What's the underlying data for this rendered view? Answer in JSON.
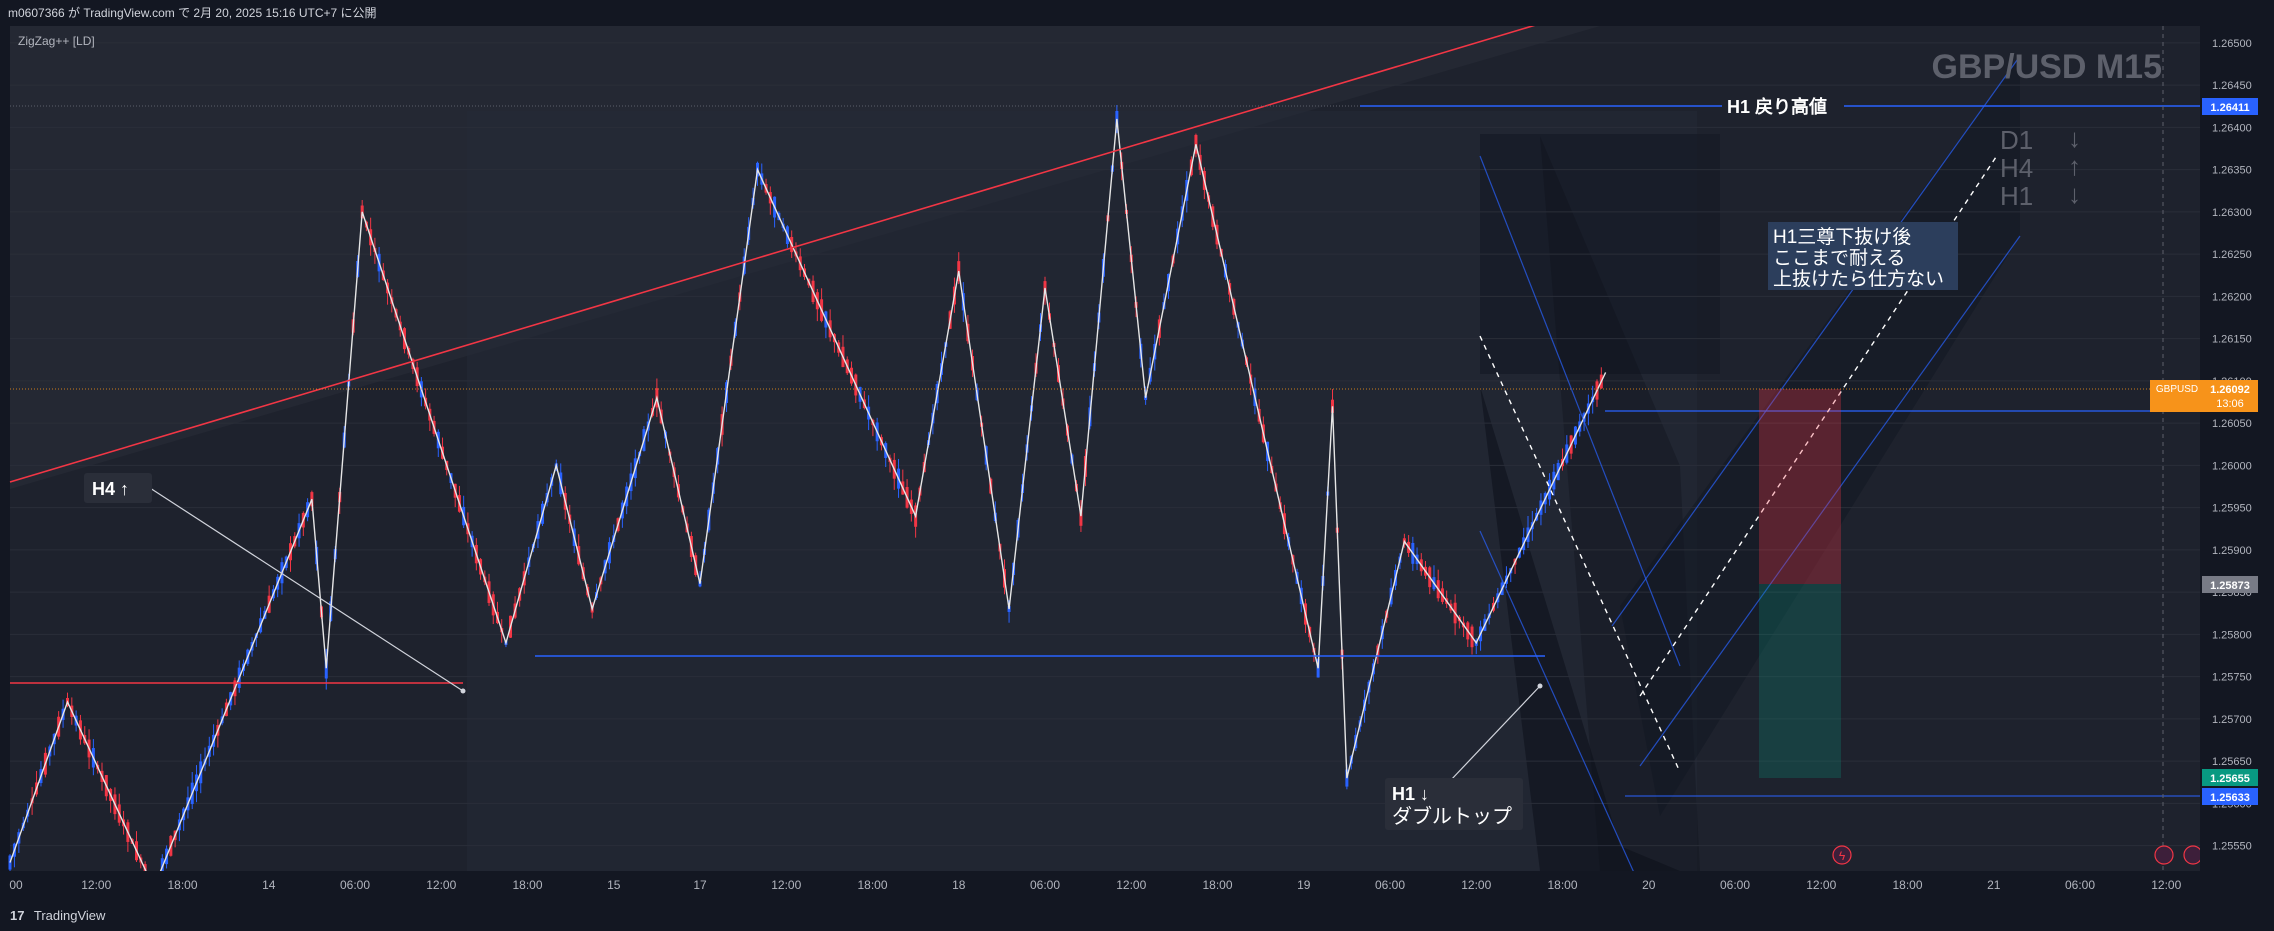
{
  "header": {
    "publish_line": "m0607366 が TradingView.com で 2月 20, 2025 15:16 UTC+7 に公開"
  },
  "footer": {
    "logo": "17",
    "brand": "TradingView"
  },
  "indicator_label": "ZigZag++ [LD]",
  "watermark": "GBP/USD M15",
  "trend_panel": [
    {
      "tf": "D1",
      "arrow": "↓"
    },
    {
      "tf": "H4",
      "arrow": "↑"
    },
    {
      "tf": "H1",
      "arrow": "↓"
    }
  ],
  "annotations": {
    "h1_high": "H1 戻り高値",
    "h4_up": "H4 ↑",
    "h1_down_title": "H1 ↓",
    "h1_down_sub": "ダブルトップ",
    "note_lines": [
      "H1三尊下抜け後",
      "ここまで耐える",
      "上抜けたら仕方ない"
    ]
  },
  "price_axis": {
    "ticks": [
      "1.26500",
      "1.26450",
      "1.26400",
      "1.26350",
      "1.26300",
      "1.26250",
      "1.26200",
      "1.26150",
      "1.26100",
      "1.26050",
      "1.26000",
      "1.25950",
      "1.25900",
      "1.25850",
      "1.25800",
      "1.25750",
      "1.25700",
      "1.25650",
      "1.25600",
      "1.25550"
    ],
    "current_symbol": "GBPUSD",
    "current_price": "1.26092",
    "countdown": "13:06",
    "level_high": "1.26411",
    "level_tp": "1.25873",
    "level_green": "1.25655",
    "level_low": "1.25633"
  },
  "time_axis": {
    "labels": [
      "00",
      "12:00",
      "18:00",
      "14",
      "06:00",
      "12:00",
      "18:00",
      "15",
      "17",
      "12:00",
      "18:00",
      "18",
      "06:00",
      "12:00",
      "18:00",
      "19",
      "06:00",
      "12:00",
      "18:00",
      "20",
      "06:00",
      "12:00",
      "18:00",
      "21",
      "06:00",
      "12:00"
    ]
  },
  "colors": {
    "background": "#131722",
    "bull": "#2962ff",
    "bear": "#f23645",
    "zigzag": "#e6e6e6",
    "resistance": "#f23645",
    "level_blue": "#2962ff",
    "current_price": "#f7931a",
    "tp_green": "#089981"
  },
  "chart_data": {
    "type": "candlestick",
    "symbol": "GBPUSD",
    "timeframe": "M15",
    "ylim": [
      1.2552,
      1.2652
    ],
    "zigzag_pivots": [
      {
        "x": "13 12:00",
        "y": 1.2553
      },
      {
        "x": "13 16:00",
        "y": 1.2572
      },
      {
        "x": "13 22:00",
        "y": 1.255
      },
      {
        "x": "14 09:00",
        "y": 1.2596
      },
      {
        "x": "14 10:00",
        "y": 1.2576
      },
      {
        "x": "14 12:30",
        "y": 1.263
      },
      {
        "x": "14 22:30",
        "y": 1.2579
      },
      {
        "x": "17 02:00",
        "y": 1.26
      },
      {
        "x": "17 04:30",
        "y": 1.2583
      },
      {
        "x": "17 09:00",
        "y": 1.2608
      },
      {
        "x": "17 12:00",
        "y": 1.2586
      },
      {
        "x": "17 16:00",
        "y": 1.2635
      },
      {
        "x": "18 03:00",
        "y": 1.2594
      },
      {
        "x": "18 06:00",
        "y": 1.2623
      },
      {
        "x": "18 09:30",
        "y": 1.2583
      },
      {
        "x": "18 12:00",
        "y": 1.2621
      },
      {
        "x": "18 14:30",
        "y": 1.2594
      },
      {
        "x": "18 17:00",
        "y": 1.2641
      },
      {
        "x": "18 19:00",
        "y": 1.2608
      },
      {
        "x": "18 22:30",
        "y": 1.2638
      },
      {
        "x": "19 07:00",
        "y": 1.2576
      },
      {
        "x": "19 08:00",
        "y": 1.2607
      },
      {
        "x": "19 09:00",
        "y": 1.2563
      },
      {
        "x": "19 13:00",
        "y": 1.2591
      },
      {
        "x": "19 18:00",
        "y": 1.2579
      },
      {
        "x": "20 03:00",
        "y": 1.2611
      }
    ],
    "levels": [
      {
        "name": "H1 戻り高値",
        "price": 1.26411
      },
      {
        "name": "GBPUSD",
        "price": 1.26092
      },
      {
        "name": "",
        "price": 1.25873
      },
      {
        "name": "",
        "price": 1.25655
      },
      {
        "name": "",
        "price": 1.25633
      }
    ],
    "xlabel": "",
    "ylabel": ""
  }
}
